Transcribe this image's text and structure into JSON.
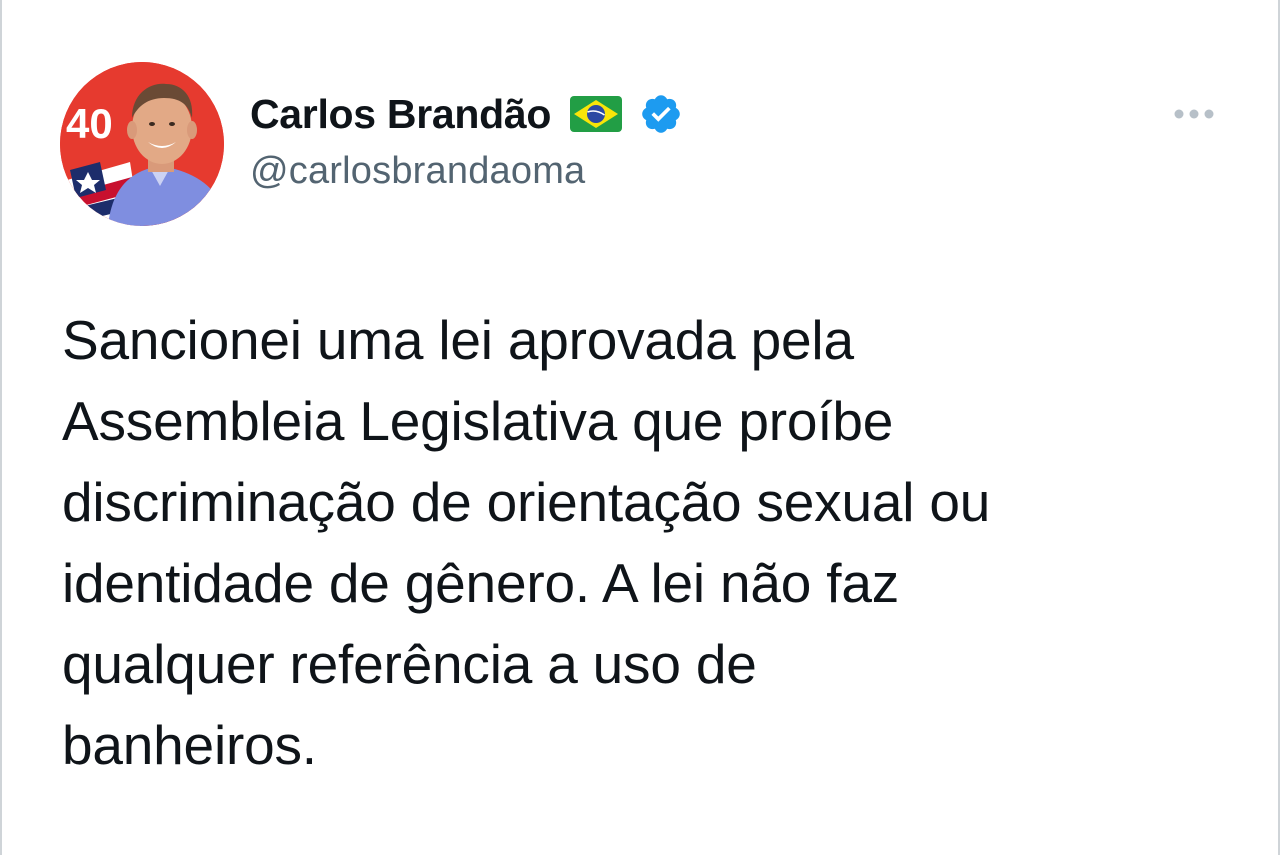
{
  "tweet": {
    "author": {
      "display_name": "Carlos Brandão",
      "handle": "@carlosbrandaoma",
      "avatar_badge_text": "40",
      "flag_icon": "brazil-flag-icon",
      "verified_icon": "verified-badge-icon"
    },
    "menu_icon": "more-options-icon",
    "text": "Sancionei uma lei aprovada pela\nAssembleia Legislativa que proíbe\ndiscriminação de orientação sexual ou\nidentidade de gênero. A lei não faz\nqualquer referência a uso de\nbanheiros."
  },
  "colors": {
    "text_primary": "#0f1419",
    "text_secondary": "#536471",
    "verified_blue": "#1d9bf0",
    "avatar_red": "#e63a2f"
  }
}
